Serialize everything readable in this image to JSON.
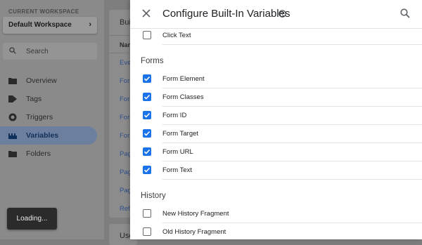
{
  "sidebar": {
    "workspace_caption": "CURRENT WORKSPACE",
    "workspace_name": "Default Workspace",
    "search_placeholder": "Search",
    "items": [
      {
        "label": "Overview",
        "icon": "folder-icon",
        "active": false
      },
      {
        "label": "Tags",
        "icon": "tag-icon",
        "active": false
      },
      {
        "label": "Triggers",
        "icon": "trigger-icon",
        "active": false
      },
      {
        "label": "Variables",
        "icon": "variables-icon",
        "active": true
      },
      {
        "label": "Folders",
        "icon": "folder-icon",
        "active": false
      }
    ]
  },
  "card": {
    "title": "Bui",
    "column_header": "Nam",
    "rows": [
      "Eve",
      "Forn",
      "Forn",
      "Forn",
      "Forn",
      "Pag",
      "Pag",
      "Pag",
      "Refe"
    ]
  },
  "card2": {
    "title": "Use"
  },
  "toast": {
    "text": "Loading..."
  },
  "panel": {
    "title": "Configure Built-In Variables",
    "top_item": {
      "label": "Click Text",
      "checked": false
    },
    "sections": [
      {
        "title": "Forms",
        "items": [
          {
            "label": "Form Element",
            "checked": true
          },
          {
            "label": "Form Classes",
            "checked": true
          },
          {
            "label": "Form ID",
            "checked": true
          },
          {
            "label": "Form Target",
            "checked": true
          },
          {
            "label": "Form URL",
            "checked": true
          },
          {
            "label": "Form Text",
            "checked": true
          }
        ]
      },
      {
        "title": "History",
        "items": [
          {
            "label": "New History Fragment",
            "checked": false
          },
          {
            "label": "Old History Fragment",
            "checked": false
          }
        ]
      }
    ]
  },
  "colors": {
    "accent": "#1a73e8",
    "active_nav": "#10305c"
  }
}
